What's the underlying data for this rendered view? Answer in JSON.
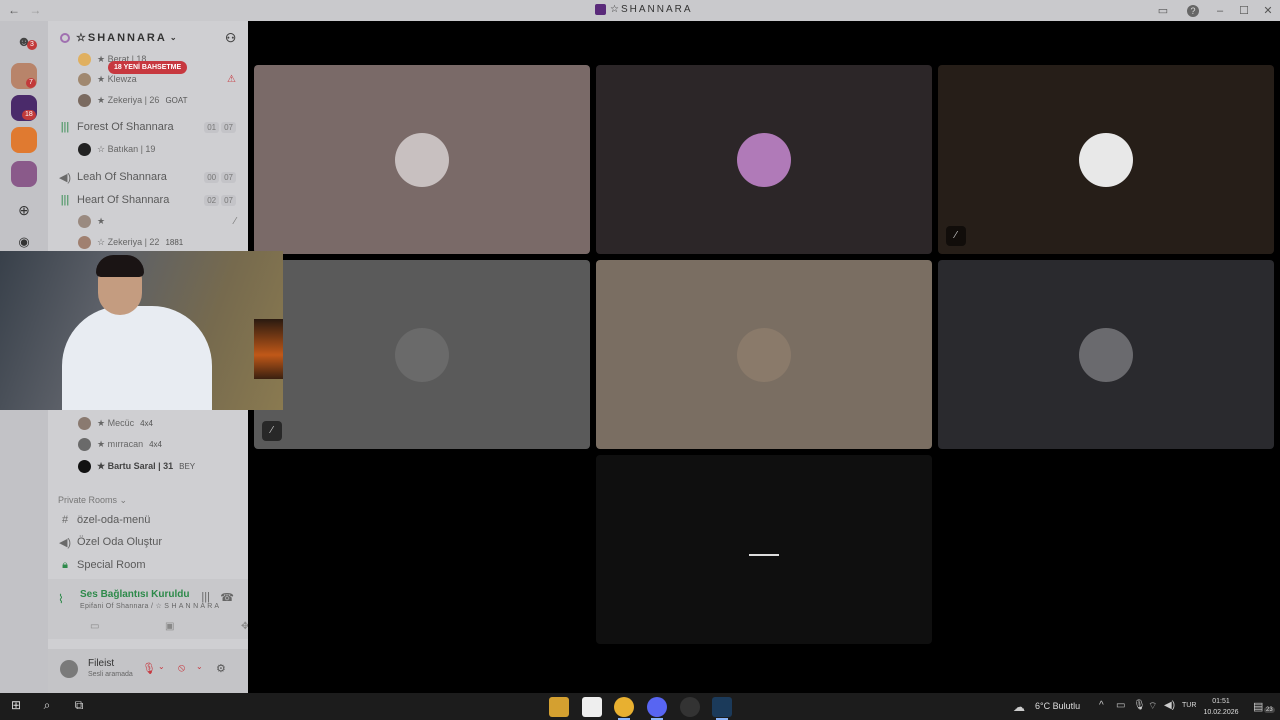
{
  "window": {
    "title": "☆SHANNARA",
    "back_icon": "←",
    "forward_icon": "→",
    "inbox_icon": "inbox-icon",
    "help_icon": "?"
  },
  "rail": {
    "dm_badge": "3",
    "server_badges": [
      "7",
      "18"
    ]
  },
  "server": {
    "name": "☆SHANNARA",
    "mention_pill": "18 YENİ BAHSETME"
  },
  "sidebar": {
    "users_top": [
      {
        "name": "★ Berat | 18",
        "tag": ""
      },
      {
        "name": "★ Klewza",
        "tag": ""
      },
      {
        "name": "★ Zekeriya | 26",
        "tag": "GOAT"
      }
    ],
    "channels": [
      {
        "name": "Forest Of Shannara",
        "count_a": "01",
        "count_b": "07"
      },
      {
        "name": "Leah Of Shannara",
        "count_a": "00",
        "count_b": "07"
      },
      {
        "name": "Heart Of Shannara",
        "count_a": "02",
        "count_b": "07"
      }
    ],
    "forest_user": "☆ Batıkan | 19",
    "heart_users": [
      {
        "name": "★",
        "tag": ""
      },
      {
        "name": "☆ Zekeriya | 22",
        "tag": "1881"
      }
    ],
    "lower_users": [
      {
        "name": "★ Mecüc",
        "tag": "4x4"
      },
      {
        "name": "★ mırracan",
        "tag": "4x4"
      },
      {
        "name": "★ Bartu Saral | 31",
        "tag": "BEY"
      }
    ],
    "category": "Private Rooms",
    "private_channels": [
      {
        "name": "özel-oda-menü"
      },
      {
        "name": "Özel Oda Oluştur"
      },
      {
        "name": "Special Room"
      }
    ]
  },
  "voice": {
    "status": "Ses Bağlantısı Kuruldu",
    "location": "Epifani Of Shannara / ☆ S H A N N A R A"
  },
  "user": {
    "name": "Fileist",
    "status": "Sesli aramada"
  },
  "taskbar": {
    "weather": "6°C  Bulutlu",
    "lang": "TUR",
    "time": "01:51",
    "date": "10.02.2026",
    "notif_count": "23"
  },
  "colors": {
    "connected": "#2d8a4a",
    "mention": "#c7383f"
  }
}
